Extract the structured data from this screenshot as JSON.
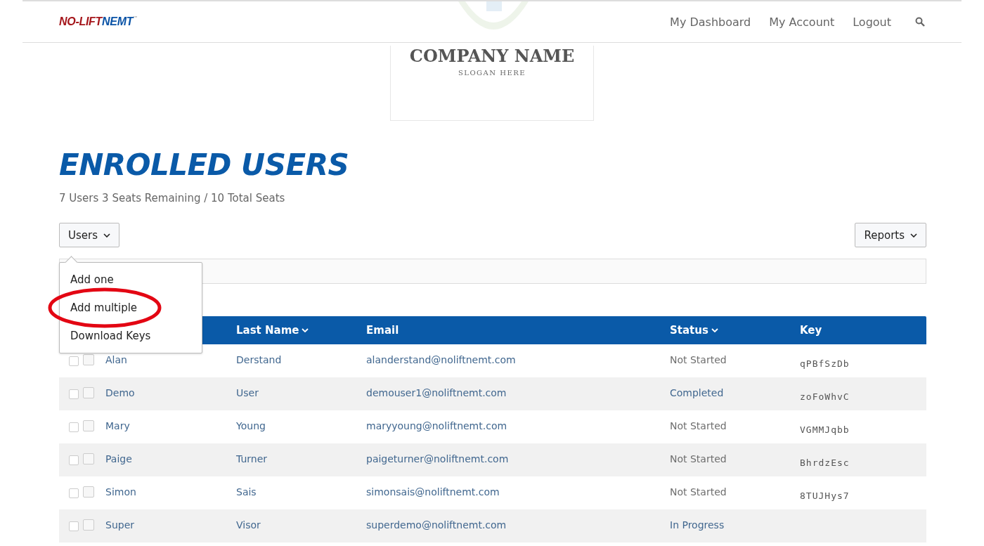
{
  "nav": {
    "logo": {
      "part1": "NO-LIFT",
      "part2": "NEMT",
      "mark": "™"
    },
    "links": [
      "My Dashboard",
      "My Account",
      "Logout"
    ]
  },
  "company": {
    "name": "COMPANY NAME",
    "slogan": "SLOGAN HERE"
  },
  "title": "ENROLLED USERS",
  "summary": "7 Users 3 Seats Remaining / 10 Total Seats",
  "users_button": "Users",
  "reports_button": "Reports",
  "users_menu": [
    {
      "label": "Add one",
      "circled": false
    },
    {
      "label": "Add multiple",
      "circled": true
    },
    {
      "label": "Download Keys",
      "circled": false
    }
  ],
  "table": {
    "columns": [
      {
        "label": "Last Name",
        "sortable": true
      },
      {
        "label": "Email",
        "sortable": false
      },
      {
        "label": "Status",
        "sortable": true
      },
      {
        "label": "Key",
        "sortable": false
      }
    ],
    "rows": [
      {
        "checkboxes": [
          {
            "checked": false
          },
          {
            "checked": false
          }
        ],
        "first": "Alan",
        "last": "Derstand",
        "email": "alanderstand@noliftnemt.com",
        "status": "Not Started",
        "status_link": false,
        "key": "qPBfSzDb"
      },
      {
        "checkboxes": [
          {
            "checked": false
          },
          {
            "checked": false
          }
        ],
        "first": "Demo",
        "last": "User",
        "email": "demouser1@noliftnemt.com",
        "status": "Completed",
        "status_link": true,
        "key": "zoFoWhvC"
      },
      {
        "checkboxes": [
          {
            "checked": false
          },
          {
            "checked": false
          }
        ],
        "first": "Mary",
        "last": "Young",
        "email": "maryyoung@noliftnemt.com",
        "status": "Not Started",
        "status_link": false,
        "key": "VGMMJqbb"
      },
      {
        "checkboxes": [
          {
            "checked": false
          },
          {
            "checked": false
          }
        ],
        "first": "Paige",
        "last": "Turner",
        "email": "paigeturner@noliftnemt.com",
        "status": "Not Started",
        "status_link": false,
        "key": "BhrdzEsc"
      },
      {
        "checkboxes": [
          {
            "checked": false
          },
          {
            "checked": false
          }
        ],
        "first": "Simon",
        "last": "Sais",
        "email": "simonsais@noliftnemt.com",
        "status": "Not Started",
        "status_link": false,
        "key": "8TUJHys7"
      },
      {
        "checkboxes": [
          {
            "checked": false
          },
          {
            "checked": false
          }
        ],
        "first": "Super",
        "last": "Visor",
        "email": "superdemo@noliftnemt.com",
        "status": "In Progress",
        "status_link": true
      }
    ]
  }
}
